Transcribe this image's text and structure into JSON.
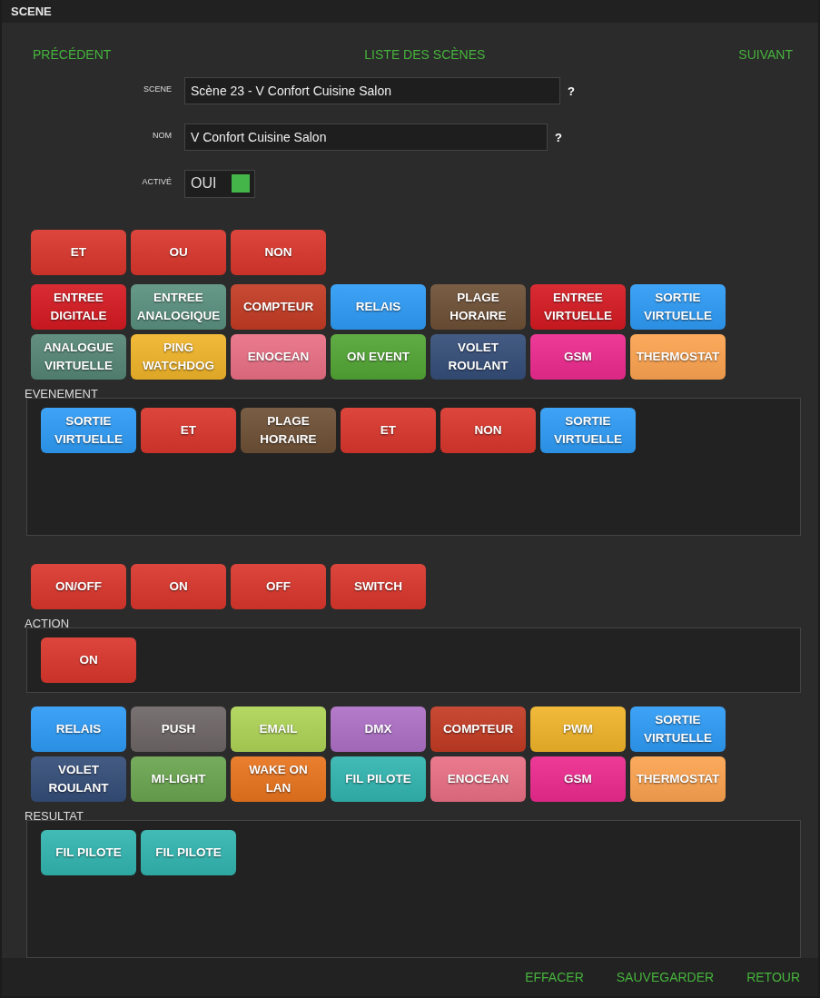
{
  "header": {
    "title": "SCENE"
  },
  "nav": {
    "previous": "PRÉCÉDENT",
    "list": "LISTE DES SCÈNES",
    "next": "SUIVANT"
  },
  "fields": [
    {
      "label": "SCENE",
      "value": "Scène 23 - V Confort Cuisine Salon",
      "help": "?"
    },
    {
      "label": "NOM",
      "value": "V Confort Cuisine Salon",
      "help": "?"
    }
  ],
  "active": {
    "label": "ACTIVÉ",
    "value": "OUI",
    "on": true
  },
  "logic_buttons": [
    {
      "label": "ET",
      "color": "#d9362c"
    },
    {
      "label": "OU",
      "color": "#d9362c"
    },
    {
      "label": "NON",
      "color": "#d9362c"
    }
  ],
  "event_palette": [
    {
      "label": "ENTREE\nDIGITALE",
      "color": "#d51a22"
    },
    {
      "label": "ENTREE\nANALOGIQUE",
      "color": "#5a907f"
    },
    {
      "label": "COMPTEUR",
      "color": "#c33b24"
    },
    {
      "label": "RELAIS",
      "color": "#2e9bf5"
    },
    {
      "label": "PLAGE\nHORAIRE",
      "color": "#6e5036"
    },
    {
      "label": "ENTREE\nVIRTUELLE",
      "color": "#d51a22"
    },
    {
      "label": "SORTIE\nVIRTUELLE",
      "color": "#2e9bf5"
    },
    {
      "label": "ANALOGUE\nVIRTUELLE",
      "color": "#558676"
    },
    {
      "label": "PING\nWATCHDOG",
      "color": "#f0b429"
    },
    {
      "label": "ENOCEAN",
      "color": "#e96f84"
    },
    {
      "label": "ON EVENT",
      "color": "#52a535"
    },
    {
      "label": "VOLET\nROULANT",
      "color": "#344d78"
    },
    {
      "label": "GSM",
      "color": "#ec2a8e"
    },
    {
      "label": "THERMOSTAT",
      "color": "#fca34f"
    }
  ],
  "event": {
    "label": "EVENEMENT",
    "items": [
      {
        "label": "SORTIE\nVIRTUELLE",
        "color": "#2e9bf5"
      },
      {
        "label": "ET",
        "color": "#d9362c"
      },
      {
        "label": "PLAGE\nHORAIRE",
        "color": "#6e5036"
      },
      {
        "label": "ET",
        "color": "#d9362c"
      },
      {
        "label": "NON",
        "color": "#d9362c"
      },
      {
        "label": "SORTIE\nVIRTUELLE",
        "color": "#2e9bf5"
      }
    ]
  },
  "action_buttons": [
    {
      "label": "ON/OFF",
      "color": "#d9362c"
    },
    {
      "label": "ON",
      "color": "#d9362c"
    },
    {
      "label": "OFF",
      "color": "#d9362c"
    },
    {
      "label": "SWITCH",
      "color": "#d9362c"
    }
  ],
  "action": {
    "label": "ACTION",
    "items": [
      {
        "label": "ON",
        "color": "#d9362c"
      }
    ]
  },
  "result_palette": [
    {
      "label": "RELAIS",
      "color": "#2e9bf5"
    },
    {
      "label": "PUSH",
      "color": "#6e6666"
    },
    {
      "label": "EMAIL",
      "color": "#aed457"
    },
    {
      "label": "DMX",
      "color": "#ad70c6"
    },
    {
      "label": "COMPTEUR",
      "color": "#c33b24"
    },
    {
      "label": "PWM",
      "color": "#f0b429"
    },
    {
      "label": "SORTIE\nVIRTUELLE",
      "color": "#2e9bf5"
    },
    {
      "label": "VOLET\nROULANT",
      "color": "#344d78"
    },
    {
      "label": "MI-LIGHT",
      "color": "#6aa54f"
    },
    {
      "label": "WAKE ON\nLAN",
      "color": "#e8741e"
    },
    {
      "label": "FIL PILOTE",
      "color": "#32b5b0"
    },
    {
      "label": "ENOCEAN",
      "color": "#e96f84"
    },
    {
      "label": "GSM",
      "color": "#ec2a8e"
    },
    {
      "label": "THERMOSTAT",
      "color": "#fca34f"
    }
  ],
  "result": {
    "label": "RESULTAT",
    "items": [
      {
        "label": "FIL PILOTE",
        "color": "#32b5b0"
      },
      {
        "label": "FIL PILOTE",
        "color": "#32b5b0"
      }
    ]
  },
  "footer": [
    "EFFACER",
    "SAUVEGARDER",
    "RETOUR"
  ]
}
